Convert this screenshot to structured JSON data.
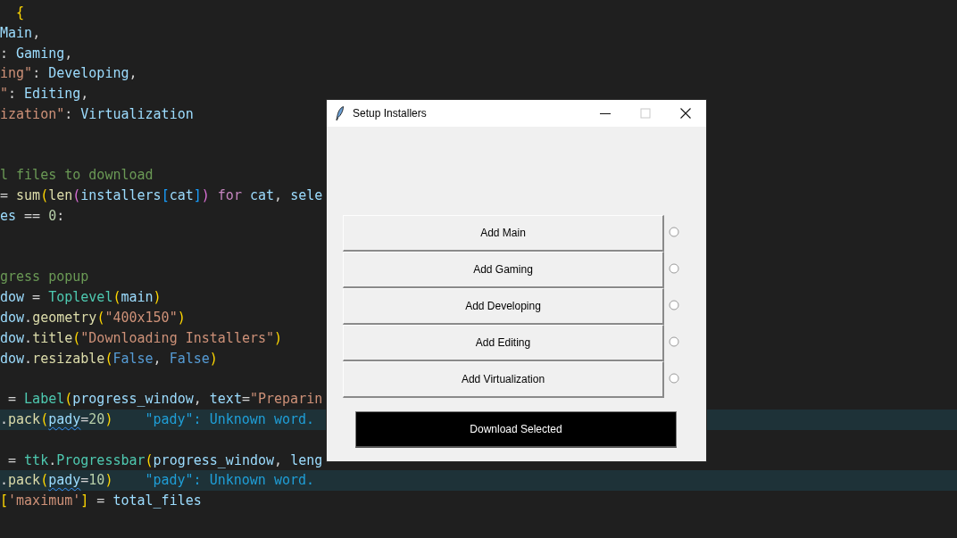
{
  "editor": {
    "lines": [
      {
        "tokens": [
          {
            "text": "  {",
            "kind": "bracket1"
          }
        ]
      },
      {
        "tokens": [
          {
            "text": "Main",
            "kind": "var"
          },
          {
            "text": ","
          }
        ]
      },
      {
        "tokens": [
          {
            "text": ": "
          },
          {
            "text": "Gaming",
            "kind": "var"
          },
          {
            "text": ","
          }
        ]
      },
      {
        "tokens": [
          {
            "text": "ing\"",
            "kind": "string"
          },
          {
            "text": ": "
          },
          {
            "text": "Developing",
            "kind": "var"
          },
          {
            "text": ","
          }
        ]
      },
      {
        "tokens": [
          {
            "text": "\"",
            "kind": "string"
          },
          {
            "text": ": "
          },
          {
            "text": "Editing",
            "kind": "var"
          },
          {
            "text": ","
          }
        ]
      },
      {
        "tokens": [
          {
            "text": "ization\"",
            "kind": "string"
          },
          {
            "text": ": "
          },
          {
            "text": "Virtualization",
            "kind": "var"
          }
        ]
      },
      {
        "kind": "widespaced",
        "tokens": [
          {
            "text": "l files to download",
            "kind": "comment"
          }
        ]
      },
      {
        "tokens": [
          {
            "text": "= "
          },
          {
            "text": "sum",
            "kind": "func"
          },
          {
            "text": "(",
            "kind": "bracket1"
          },
          {
            "text": "len",
            "kind": "func"
          },
          {
            "text": "(",
            "kind": "bracket2"
          },
          {
            "text": "installers",
            "kind": "var"
          },
          {
            "text": "[",
            "kind": "bracket3"
          },
          {
            "text": "cat",
            "kind": "var"
          },
          {
            "text": "]",
            "kind": "bracket3"
          },
          {
            "text": ")",
            "kind": "bracket2"
          },
          {
            "text": " for ",
            "kind": "keyword"
          },
          {
            "text": "cat",
            "kind": "var"
          },
          {
            "text": ", "
          },
          {
            "text": "sele",
            "kind": "var"
          }
        ]
      },
      {
        "tokens": [
          {
            "text": "es",
            "kind": "var"
          },
          {
            "text": " == "
          },
          {
            "text": "0",
            "kind": "number"
          },
          {
            "text": ":"
          }
        ]
      },
      {
        "kind": "widespaced",
        "tokens": [
          {
            "text": "gress popup",
            "kind": "comment"
          }
        ]
      },
      {
        "tokens": [
          {
            "text": "dow",
            "kind": "var"
          },
          {
            "text": " = "
          },
          {
            "text": "Toplevel",
            "kind": "class"
          },
          {
            "text": "(",
            "kind": "bracket1"
          },
          {
            "text": "main",
            "kind": "var"
          },
          {
            "text": ")",
            "kind": "bracket1"
          }
        ]
      },
      {
        "tokens": [
          {
            "text": "dow",
            "kind": "var"
          },
          {
            "text": "."
          },
          {
            "text": "geometry",
            "kind": "func"
          },
          {
            "text": "(",
            "kind": "bracket1"
          },
          {
            "text": "\"400x150\"",
            "kind": "string"
          },
          {
            "text": ")",
            "kind": "bracket1"
          }
        ]
      },
      {
        "tokens": [
          {
            "text": "dow",
            "kind": "var"
          },
          {
            "text": "."
          },
          {
            "text": "title",
            "kind": "func"
          },
          {
            "text": "(",
            "kind": "bracket1"
          },
          {
            "text": "\"Downloading Installers\"",
            "kind": "string"
          },
          {
            "text": ")",
            "kind": "bracket1"
          }
        ]
      },
      {
        "tokens": [
          {
            "text": "dow",
            "kind": "var"
          },
          {
            "text": "."
          },
          {
            "text": "resizable",
            "kind": "func"
          },
          {
            "text": "(",
            "kind": "bracket1"
          },
          {
            "text": "False",
            "kind": "constant"
          },
          {
            "text": ", "
          },
          {
            "text": "False",
            "kind": "constant"
          },
          {
            "text": ")",
            "kind": "bracket1"
          }
        ]
      },
      {
        "kind": "spaced",
        "tokens": [
          {
            "text": " = "
          },
          {
            "text": "Label",
            "kind": "class"
          },
          {
            "text": "(",
            "kind": "bracket1"
          },
          {
            "text": "progress_window",
            "kind": "var"
          },
          {
            "text": ", "
          },
          {
            "text": "text",
            "kind": "var"
          },
          {
            "text": "="
          },
          {
            "text": "\"Preparin",
            "kind": "string"
          }
        ]
      },
      {
        "highlighted": true,
        "hint": "\"pady\": Unknown word.",
        "tokens": [
          {
            "text": "."
          },
          {
            "text": "pack",
            "kind": "func"
          },
          {
            "text": "(",
            "kind": "bracket1"
          },
          {
            "text": "pady",
            "kind": "misspelled"
          },
          {
            "text": "="
          },
          {
            "text": "20",
            "kind": "number"
          },
          {
            "text": ")",
            "kind": "bracket1"
          }
        ]
      },
      {
        "kind": "spaced",
        "tokens": [
          {
            "text": " = "
          },
          {
            "text": "ttk",
            "kind": "class"
          },
          {
            "text": "."
          },
          {
            "text": "Progressbar",
            "kind": "class"
          },
          {
            "text": "(",
            "kind": "bracket1"
          },
          {
            "text": "progress_window",
            "kind": "var"
          },
          {
            "text": ", "
          },
          {
            "text": "leng",
            "kind": "var"
          }
        ]
      },
      {
        "highlighted": true,
        "hint": "\"pady\": Unknown word.",
        "tokens": [
          {
            "text": "."
          },
          {
            "text": "pack",
            "kind": "func"
          },
          {
            "text": "(",
            "kind": "bracket1"
          },
          {
            "text": "pady",
            "kind": "misspelled"
          },
          {
            "text": "="
          },
          {
            "text": "10",
            "kind": "number"
          },
          {
            "text": ")",
            "kind": "bracket1"
          }
        ]
      },
      {
        "tokens": [
          {
            "text": "[",
            "kind": "bracket1"
          },
          {
            "text": "'maximum'",
            "kind": "string"
          },
          {
            "text": "]",
            "kind": "bracket1"
          },
          {
            "text": " = "
          },
          {
            "text": "total_files",
            "kind": "var"
          }
        ]
      }
    ]
  },
  "window": {
    "title": "Setup Installers",
    "maximize_disabled": true,
    "options": [
      {
        "label": "Add Main",
        "selected": false
      },
      {
        "label": "Add Gaming",
        "selected": false
      },
      {
        "label": "Add Developing",
        "selected": false
      },
      {
        "label": "Add Editing",
        "selected": false
      },
      {
        "label": "Add Virtualization",
        "selected": false
      }
    ],
    "action": "Download Selected"
  }
}
